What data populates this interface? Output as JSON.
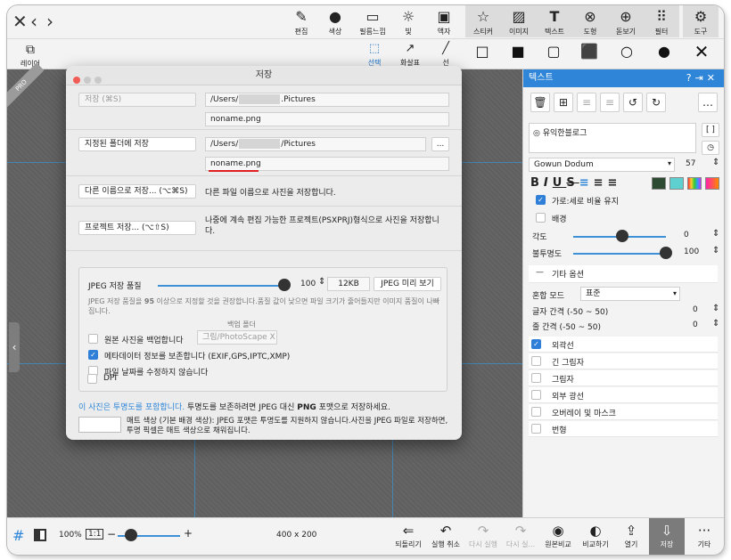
{
  "topbar": {
    "nav": {
      "close": "✕",
      "back": "‹",
      "forward": "›"
    },
    "tools": [
      {
        "label": "편집",
        "icon": "edit-icon",
        "glyph": "✎"
      },
      {
        "label": "색상",
        "icon": "color-icon",
        "glyph": "●"
      },
      {
        "label": "필름느낌",
        "icon": "film-icon",
        "glyph": "▭"
      },
      {
        "label": "빛",
        "icon": "light-icon",
        "glyph": "☼"
      },
      {
        "label": "액자",
        "icon": "frame-icon",
        "glyph": "▣"
      },
      {
        "label": "스티커",
        "icon": "sticker-icon",
        "glyph": "☆"
      },
      {
        "label": "이미지",
        "icon": "image-icon",
        "glyph": "▨"
      },
      {
        "label": "텍스트",
        "icon": "text-icon",
        "glyph": "T"
      },
      {
        "label": "도형",
        "icon": "shape-icon",
        "glyph": "⊗"
      },
      {
        "label": "돋보기",
        "icon": "magnifier-icon",
        "glyph": "⊕"
      },
      {
        "label": "필터",
        "icon": "filter-icon",
        "glyph": "⠿"
      },
      {
        "label": "도구",
        "icon": "tools-icon",
        "glyph": "⚙"
      }
    ]
  },
  "bar2": {
    "layer_label": "레이어",
    "select_label": "선택",
    "arrow_label": "화살표",
    "line_label": "선"
  },
  "dialog": {
    "title": "저장",
    "save_button": "저장 (⌘S)",
    "save_path": [
      "/Users/",
      ".Pictures"
    ],
    "save_filename": "noname.png",
    "fixed_folder_button": "지정된 폴더에 저장",
    "fixed_path": [
      "/Users/",
      "/Pictures"
    ],
    "browse_label": "...",
    "fixed_filename": "noname.png",
    "save_as_button": "다른 이름으로 저장... (⌥⌘S)",
    "save_as_desc": "다른 파일 이름으로 사진을 저장합니다.",
    "project_button": "프로젝트 저장... (⌥⇧S)",
    "project_desc": "나중에 계속 편집 가능한 프로젝트(PSXPRJ)형식으로 사진을 저장합니다.",
    "jpeg": {
      "quality_label": "JPEG 저장 품질",
      "quality_value": "100",
      "quality": 100,
      "size": "12KB",
      "preview_button": "JPEG 미리 보기",
      "hint_pre": "JPEG 저장 품질을 ",
      "hint_num": "95",
      "hint_post": " 이상으로 지정할 것을 권장합니다.품질 값이 낮으면 파일 크기가 줄어들지만 이미지 품질이 나빠집니다.",
      "backup_folder_label": "백업 폴더",
      "backup_checkbox": "원본 사진을 백업합니다",
      "backup_folder_value": "그림/PhotoScape X",
      "metadata_checkbox": "메타데이터 정보를 보존합니다 (EXIF,GPS,IPTC,XMP)",
      "filedate_checkbox": "파일 날짜를 수정하지 않습니다",
      "dpi_checkbox": "DPI"
    },
    "transparency_link": "이 사진은 투명도를 포함합니다.",
    "transparency_note_pre": " 투명도를 보존하려면 JPEG 대신 ",
    "transparency_note_bold": "PNG",
    "transparency_note_post": " 포맷으로 저장하세요.",
    "matte_desc": "매트 색상 (기본 배경 색상): JPEG 포맷은 투명도를 지원하지 않습니다.사진을 JPEG 파일로 저장하면,투명 픽셀은 매트 색상으로 채워집니다."
  },
  "panel": {
    "title": "텍스트",
    "text_value": "◎ 유익한블로그",
    "font_name": "Gowun Dodum",
    "font_size": "57",
    "keep_ratio": "가로:세로 비율 유지",
    "background": "배경",
    "angle_label": "각도",
    "angle_value": "0",
    "opacity_label": "불투명도",
    "opacity_value": "100",
    "opacity": 100,
    "other_options": "기타 옵션",
    "blend_label": "혼합 모드",
    "blend_value": "표준",
    "letter_spacing_label": "글자 간격 (-50 ~ 50)",
    "letter_spacing_value": "0",
    "line_spacing_label": "줄 간격 (-50 ~ 50)",
    "line_spacing_value": "0",
    "effects": [
      {
        "label": "외곽선",
        "checked": true
      },
      {
        "label": "긴 그림자",
        "checked": false
      },
      {
        "label": "그림자",
        "checked": false
      },
      {
        "label": "외부 광선",
        "checked": false
      },
      {
        "label": "오버레이 및 마스크",
        "checked": false
      },
      {
        "label": "번형",
        "checked": false
      }
    ]
  },
  "bottombar": {
    "zoom": "100%",
    "ratio": "1:1",
    "canvas_size": "400 x 200",
    "actions": [
      {
        "label": "되돌리기",
        "icon": "revert-icon",
        "glyph": "⇐",
        "dim": false
      },
      {
        "label": "실행 취소",
        "icon": "undo-icon",
        "glyph": "↶",
        "dim": false
      },
      {
        "label": "다시 실행",
        "icon": "redo-icon",
        "glyph": "↷",
        "dim": true
      },
      {
        "label": "다시 실...",
        "icon": "redo-all-icon",
        "glyph": "↷",
        "dim": true
      },
      {
        "label": "원본비교",
        "icon": "compare-original-icon",
        "glyph": "◉",
        "dim": false
      },
      {
        "label": "비교하기",
        "icon": "compare-icon",
        "glyph": "◐",
        "dim": false
      },
      {
        "label": "열기",
        "icon": "open-icon",
        "glyph": "⇪",
        "dim": false
      },
      {
        "label": "저장",
        "icon": "save-icon",
        "glyph": "⇩",
        "dim": false
      },
      {
        "label": "기타",
        "icon": "more-icon",
        "glyph": "···",
        "dim": false
      }
    ]
  },
  "colors": {
    "accent": "#2f86d8",
    "canvas": "#5f5f5f",
    "guide": "#3d8fc9",
    "red_underline": "#e02020"
  }
}
